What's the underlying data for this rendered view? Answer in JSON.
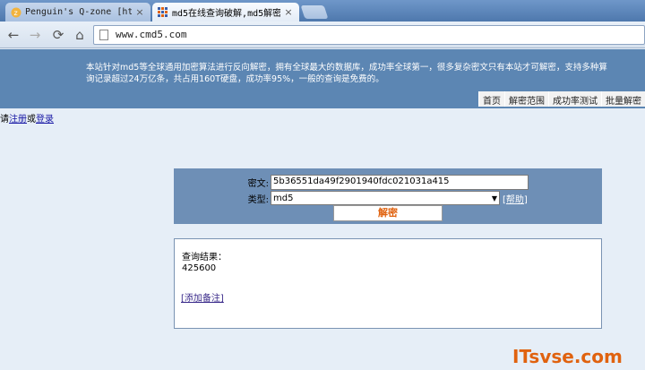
{
  "browser": {
    "tabs": [
      {
        "title": "Penguin's Q-zone [http",
        "favicon": "qzone-icon",
        "active": false
      },
      {
        "title": "md5在线查询破解,md5解密",
        "favicon": "cmd5-icon",
        "active": true
      }
    ],
    "close_glyph": "×",
    "url": "www.cmd5.com",
    "nav": {
      "back": "←",
      "forward": "→",
      "reload": "⟳",
      "home": "⌂"
    }
  },
  "header": {
    "intro_line1": "本站针对md5等全球通用加密算法进行反向解密，拥有全球最大的数据库，成功率全球第一，很多复杂密文只有本站才可解密，支持多种算",
    "intro_line2": "询记录超过24万亿条，共占用160T硬盘，成功率95%，一般的查询是免费的。",
    "nav_links": [
      "首页",
      "解密范围",
      "成功率测试",
      "批量解密"
    ]
  },
  "login": {
    "prefix": "请",
    "register": "注册",
    "or": "或",
    "login": "登录"
  },
  "form": {
    "cipher_label": "密文:",
    "cipher_value": "5b36551da49f2901940fdc021031a415",
    "type_label": "类型:",
    "type_value": "md5",
    "help_link": "[帮助]",
    "decrypt_button": "解密"
  },
  "result": {
    "label": "查询结果：",
    "value": "425600",
    "add_note": "[添加备注]"
  },
  "watermark": "ITsvse.com",
  "colors": {
    "header_bg": "#5c86b3",
    "form_bg": "#6e8fb6",
    "accent": "#e0620f"
  }
}
